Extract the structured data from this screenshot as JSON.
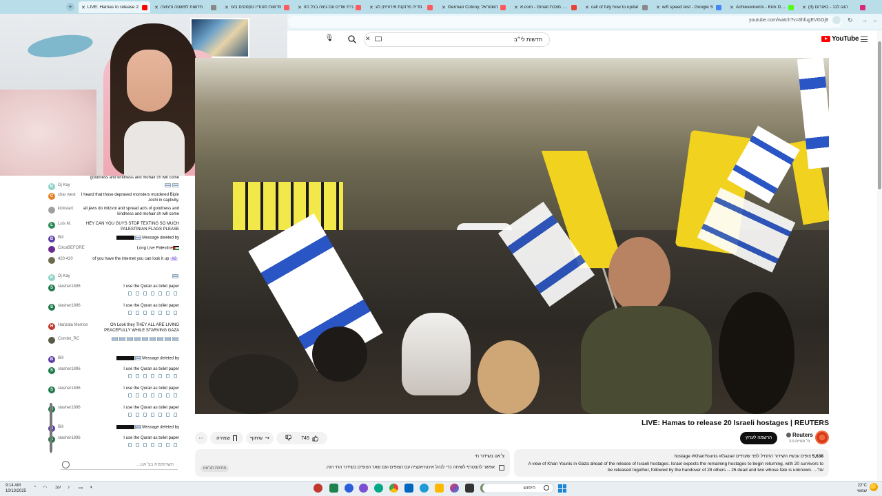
{
  "browser": {
    "tabs": [
      {
        "label": "LIVE: Hamas to release 2",
        "color": "#ff0000",
        "active": true
      },
      {
        "label": "חדשות לפשטה ורצועה",
        "color": "#888888",
        "active": false
      },
      {
        "label": "חדשות סטודיו טקסטים בעז",
        "color": "#ff5a5f",
        "active": false
      },
      {
        "label": "בית שדים עם גיצה בכל הזו",
        "color": "#ff5a5f",
        "active": false
      },
      {
        "label": "מדיה פרנקות אירוויזיון לע",
        "color": "#ff5a5f",
        "active": false
      },
      {
        "label": "German Colony, השטראל",
        "color": "#ff5a5f",
        "active": false
      },
      {
        "label": "א.com - Gmail רגשה מצבת",
        "color": "#ea4335",
        "active": false
      },
      {
        "label": "call of futy how to updat",
        "color": "#888888",
        "active": false
      },
      {
        "label": "wifi speed test - Google S",
        "color": "#4285f4",
        "active": false
      },
      {
        "label": "Achievements - Kick Dash",
        "color": "#53fc18",
        "active": false
      },
      {
        "label": "(3) הוגו לבנ - באנרום",
        "color": "#d62976",
        "active": false
      }
    ],
    "url": "youtube.com/watch?v=6hfugEVGGj8"
  },
  "masthead": {
    "search_value": "חדשות לי״ב",
    "logo_text": "YouTube"
  },
  "chat": {
    "messages": [
      {
        "author": "",
        "text": "goodness and kindness and mohair ch will come",
        "avatar": "",
        "avatar_color": "#ffffff"
      },
      {
        "author": "Dj Kay",
        "text": "",
        "flags": 2,
        "avatar": "K",
        "avatar_color": "#8fd3c8"
      },
      {
        "author": "char west",
        "text": "I heard that those depraved monsters murdered Bipin Joshi in captivity.",
        "avatar": "C",
        "avatar_color": "#e67e22"
      },
      {
        "author": "kickstart",
        "text": "all jews do mitzvot and spread acts of goodness and kindness and mohair ch will come",
        "avatar": "",
        "avatar_color": "#a0a0a0"
      },
      {
        "author": "Luis M.",
        "text": "HEY CAN YOU GUYS STOP TEXTING SO MUCH PALESTINIAN FLAGS PLEASE",
        "avatar": "L",
        "avatar_color": "#2e8b57"
      },
      {
        "author": "Bill",
        "text": "Message deleted by",
        "flags": 1,
        "redacted": true,
        "avatar": "B",
        "avatar_color": "#5b3fa8"
      },
      {
        "author": "CircaBEFORE",
        "text": "Long Live Palestine",
        "pflag": true,
        "avatar": "",
        "avatar_color": "#6a2c91"
      },
      {
        "author": "420 420",
        "text": "of you have the internet you can look it up",
        "tag": "#2",
        "avatar": "",
        "avatar_color": "#6b6b4f"
      },
      {
        "author": "Dj Kay",
        "text": "",
        "flags": 1,
        "avatar": "K",
        "avatar_color": "#8fd3c8"
      },
      {
        "author": "slasher1896",
        "text": "I use the Quran as toilet paper",
        "tp": true,
        "avatar": "S",
        "avatar_color": "#1f7a4a"
      },
      {
        "author": "slasher1896",
        "text": "I use the Quran as toilet paper",
        "tp": true,
        "avatar": "S",
        "avatar_color": "#1f7a4a"
      },
      {
        "author": "Hanzala Memon",
        "text": "Oh Look they THEY ALL ARE LIVING PEACEFULLY WHILE STARVING GAZA",
        "avatar": "H",
        "avatar_color": "#c0392b"
      },
      {
        "author": "Combo_RC",
        "text": "",
        "flags": 9,
        "avatar": "",
        "avatar_color": "#5a5a48"
      },
      {
        "author": "Bill",
        "text": "Message deleted by",
        "flags": 1,
        "redacted": true,
        "avatar": "B",
        "avatar_color": "#5b3fa8"
      },
      {
        "author": "slasher1896",
        "text": "I use the Quran as toilet paper",
        "tp": true,
        "avatar": "S",
        "avatar_color": "#1f7a4a"
      },
      {
        "author": "slasher1896",
        "text": "I use the Quran as toilet paper",
        "tp": true,
        "avatar": "S",
        "avatar_color": "#1f7a4a"
      },
      {
        "author": "slasher1896",
        "text": "I use the Quran as toilet paper",
        "tp": true,
        "avatar": "S",
        "avatar_color": "#1f7a4a"
      },
      {
        "author": "Bill",
        "text": "Message deleted by",
        "flags": 1,
        "redacted": true,
        "avatar": "B",
        "avatar_color": "#5b3fa8"
      },
      {
        "author": "slasher1896",
        "text": "I use the Quran as toilet paper",
        "tp": true,
        "avatar": "S",
        "avatar_color": "#1f7a4a"
      }
    ],
    "input_placeholder": "השתתפות בצ׳אט..."
  },
  "video": {
    "title": "LIVE: Hamas to release 20 Israeli hostages | REUTERS",
    "channel_name": "Reuters",
    "channel_subs": "3.9 מ׳ מנויים",
    "subscribe_label": "הרשמה לערוץ",
    "like_count": "745",
    "share_label": "שיתוף",
    "save_label": "שמירה",
    "more_label": "⋯"
  },
  "description": {
    "views": "5,638",
    "meta_rest": "צופים עכשיו  השידור התחיל לפני שעתיים  #hostage #KhanYounis #Gaza",
    "text": "A view of Khan Younis in Gaza ahead of the release of Israeli hostages. Israel expects the remaining hostages to begin returning, with 20 survivors to be released together, followed by the handover of 28 others -- 26 dead and two whose fate is unknown. ...עוד"
  },
  "chapter": {
    "title": "צ׳אט בשידור חי",
    "text": "אפשר להצטרף לשיחה כדי לנהל אינטראקציה עם הצופים ועם שאר הצופים בשידור החי הזה.",
    "tag": "פתיחת הצ׳אט"
  },
  "taskbar": {
    "time": "9:14 AM",
    "date": "10/13/2025",
    "search_label": "חיפוש",
    "temp": "22°C",
    "weather_label": "שמשי",
    "lang": "עב"
  }
}
